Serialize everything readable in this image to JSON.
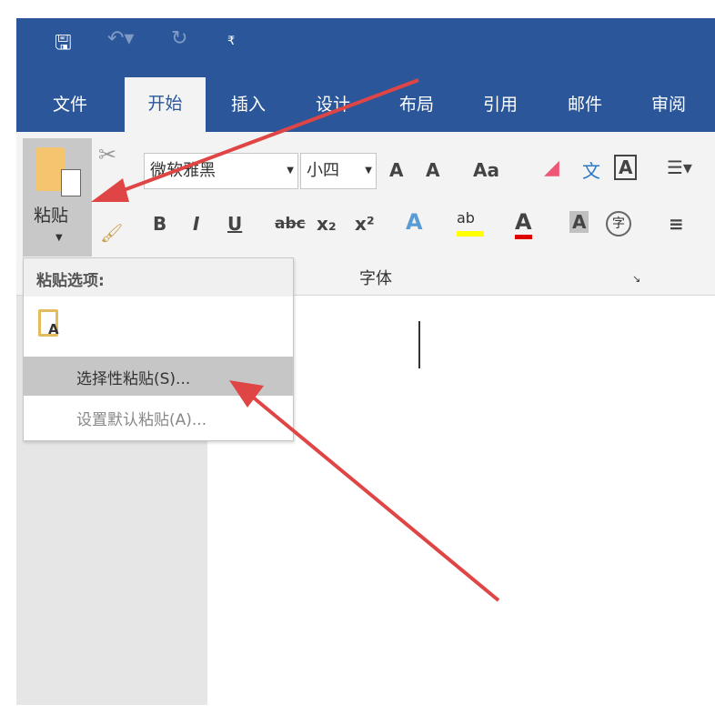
{
  "quick_access": {
    "save": "save-icon",
    "undo": "undo-icon",
    "redo": "redo-icon",
    "customize": "customize-icon"
  },
  "tabs": [
    "文件",
    "开始",
    "插入",
    "设计",
    "布局",
    "引用",
    "邮件",
    "审阅"
  ],
  "ribbon": {
    "paste_label": "粘贴",
    "font_name": "微软雅黑",
    "font_size": "小四",
    "font_group_label": "字体",
    "bold": "B",
    "italic": "I",
    "underline": "U",
    "strike": "abc",
    "subscript": "x₂",
    "superscript": "x²",
    "grow": "A",
    "shrink": "A",
    "case": "Aa",
    "text_effect": "A",
    "font_color": "A",
    "char_shade": "A",
    "char_border": "A",
    "enclose": "字",
    "phonetic": "文"
  },
  "paste_menu": {
    "header": "粘贴选项:",
    "items": [
      "选择性粘贴(S)...",
      "设置默认粘贴(A)..."
    ]
  },
  "colors": {
    "title_bar": "#2b579a",
    "arrow": "#e04545",
    "highlight": "#ffff00",
    "font_color": "#e00000"
  }
}
